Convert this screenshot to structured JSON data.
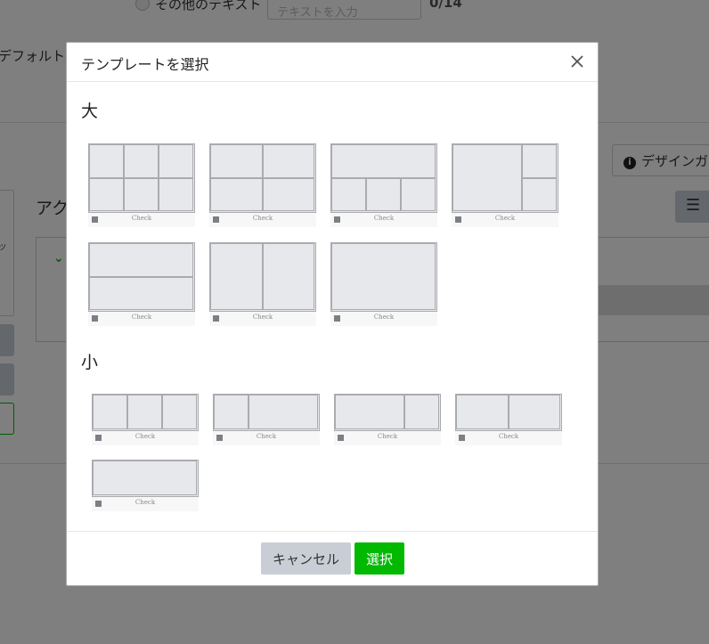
{
  "background": {
    "radio_label": "その他のテキスト",
    "input_placeholder": "テキストを入力",
    "char_count": "0/14",
    "default_label": "デフォルト表",
    "design_guide": "デザインガ",
    "action_title": "アク",
    "left_panel_text": "ッ",
    "list_icon": "☰",
    "chevron": "⌄"
  },
  "modal": {
    "title": "テンプレートを選択",
    "close_icon": "close-icon",
    "large_label": "大",
    "small_label": "小",
    "check_label": "Check",
    "cancel_label": "キャンセル",
    "select_label": "選択",
    "large_templates": [
      "2x3-grid",
      "2x2-grid",
      "1-top-3-bottom",
      "1-left-2-right",
      "2-rows",
      "2-columns",
      "single"
    ],
    "small_templates": [
      "3-columns",
      "1-narrow-2-wide",
      "1-wide-1-narrow",
      "2-columns",
      "single"
    ]
  },
  "colors": {
    "accent": "#00b900",
    "cancel_bg": "#c9ced6",
    "tile_fill": "#e6e8eb",
    "tile_border": "#a9abae"
  }
}
